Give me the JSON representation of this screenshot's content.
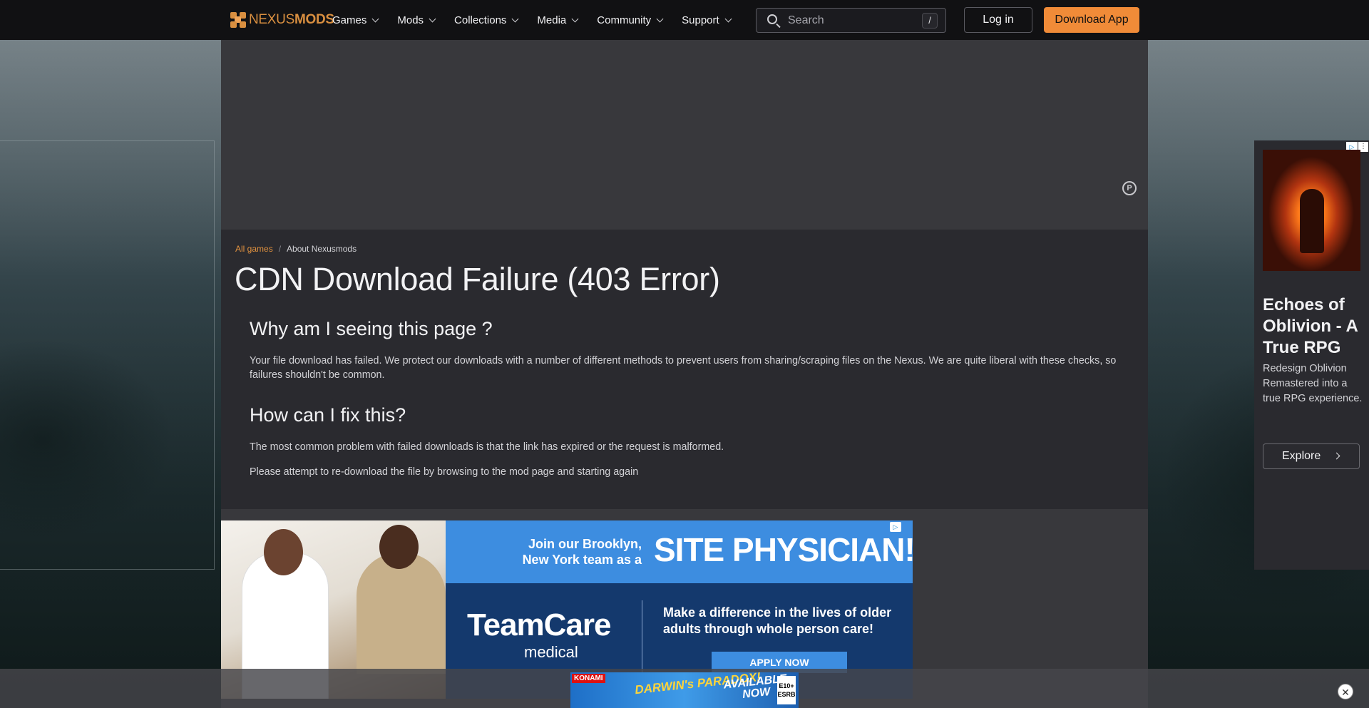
{
  "header": {
    "logo_nexus": "NEXUS",
    "logo_mods": "MODS",
    "nav": [
      {
        "label": "Games"
      },
      {
        "label": "Mods"
      },
      {
        "label": "Collections"
      },
      {
        "label": "Media"
      },
      {
        "label": "Community"
      },
      {
        "label": "Support"
      }
    ],
    "search_placeholder": "Search",
    "search_shortcut": "/",
    "login_label": "Log in",
    "download_label": "Download App",
    "accent_color": "#f08b38"
  },
  "breadcrumb": {
    "root": "All games",
    "separator": "/",
    "current": "About Nexusmods"
  },
  "page": {
    "title": "CDN Download Failure (403 Error)",
    "section1_heading": "Why am I seeing this page ?",
    "section1_text": "Your file download has failed. We protect our downloads with a number of different methods to prevent users from sharing/scraping files on the Nexus. We are quite liberal with these checks, so failures shouldn't be common.",
    "section2_heading": "How can I fix this?",
    "section2_text1": "The most common problem with failed downloads is that the link has expired or the request is malformed.",
    "section2_text2": "Please attempt to re-download the file by browsing to the mod page and starting again"
  },
  "top_ad": {
    "icon": "p-icon",
    "glyph": "P"
  },
  "banner_ad": {
    "headline_small": "Join our Brooklyn, New York team as a",
    "headline_big": "SITE PHYSICIAN!",
    "brand": "TeamCare",
    "brand_sub": "medical",
    "message": "Make a difference in the lives of older adults through whole person care!",
    "cta": "APPLY NOW",
    "adchoice_glyph": "▷"
  },
  "side_ad": {
    "heading": "Echoes of Oblivion - A True RPG",
    "body": "Redesign Oblivion Remastered into a true RPG experience.",
    "cta": "Explore",
    "adchoice_glyph": "▷",
    "close_glyph": "⋮"
  },
  "sticky_ad": {
    "brand": "KONAMI",
    "game": "DARWIN's PARADOX!",
    "availability": "AVAILABLE NOW",
    "rating": "E10+ ESRB",
    "close_glyph": "✕"
  }
}
